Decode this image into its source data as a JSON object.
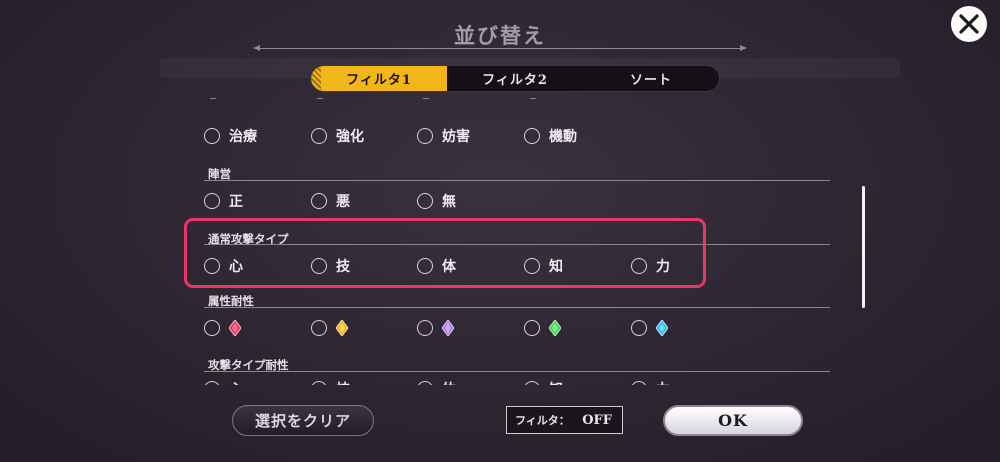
{
  "header": {
    "title": "並び替え"
  },
  "tabs": [
    {
      "label": "フィルタ1",
      "active": true
    },
    {
      "label": "フィルタ2",
      "active": false
    },
    {
      "label": "ソート",
      "active": false
    }
  ],
  "role_row": {
    "options": [
      "治療",
      "強化",
      "妨害",
      "機動"
    ]
  },
  "alignment": {
    "label": "陣営",
    "options": [
      "正",
      "悪",
      "無"
    ]
  },
  "attack_type": {
    "label": "通常攻撃タイプ",
    "options": [
      "心",
      "技",
      "体",
      "知",
      "力"
    ]
  },
  "attribute_resistance": {
    "label": "属性耐性",
    "gems": [
      {
        "icon": "red-gem-icon",
        "color": "#e8385f"
      },
      {
        "icon": "yellow-gem-icon",
        "color": "#f2b21d"
      },
      {
        "icon": "purple-gem-icon",
        "color": "#b07ad6"
      },
      {
        "icon": "green-gem-icon",
        "color": "#3fd64a"
      },
      {
        "icon": "blue-gem-icon",
        "color": "#2fb8ea"
      }
    ]
  },
  "attack_type_resistance": {
    "label": "攻撃タイプ耐性",
    "options": [
      "心",
      "技",
      "体",
      "知",
      "力"
    ]
  },
  "footer": {
    "clear_label": "選択をクリア",
    "filter_key": "フィルタ：",
    "filter_value": "OFF",
    "ok_label": "OK"
  },
  "colors": {
    "accent": "#f2b51a",
    "highlight": "#ec3467"
  }
}
